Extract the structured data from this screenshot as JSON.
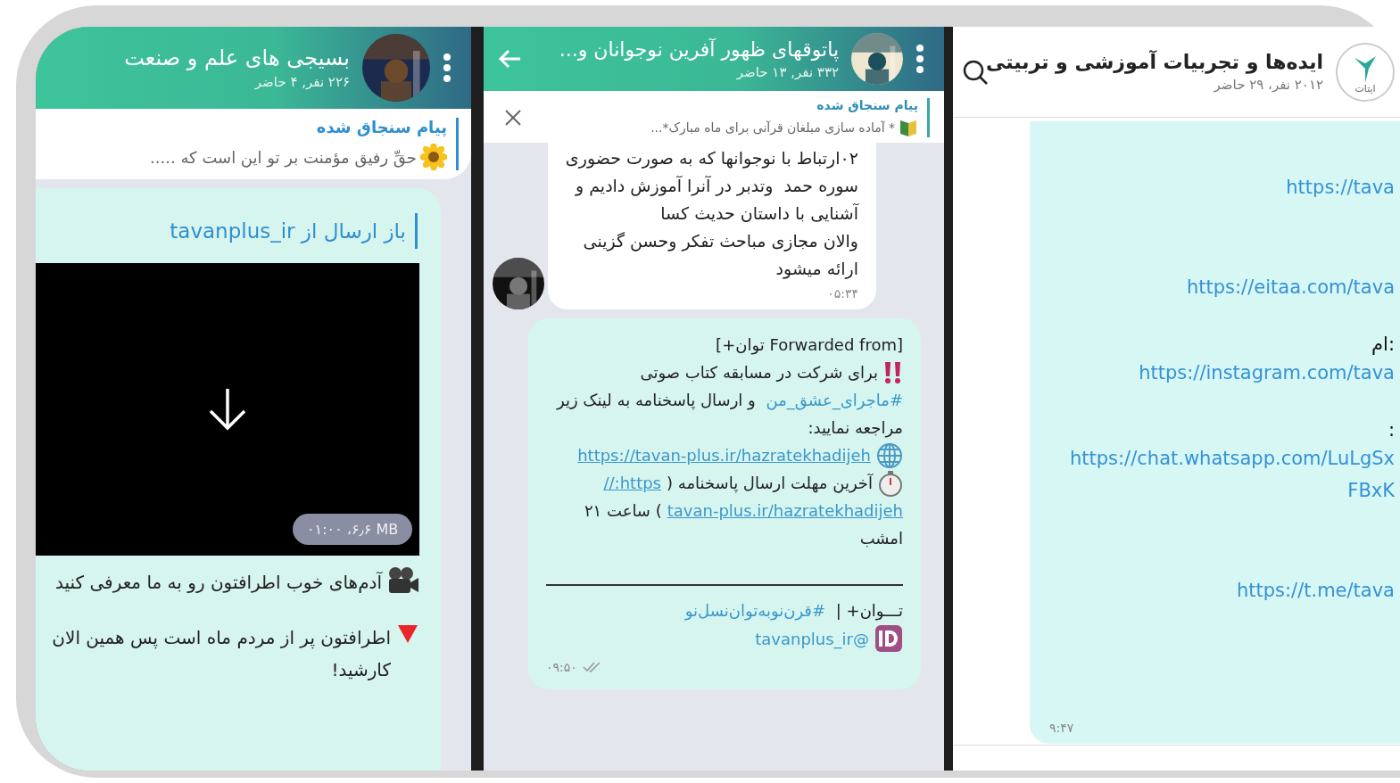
{
  "left_chat": {
    "header": {
      "title": "بسیجی های علم و صنعت",
      "subtitle": "۲۲۶ نفر, ۴ حاضر"
    },
    "pinned": {
      "label": "پیام سنجاق شده",
      "text": "حقِّ رفیق مؤمنت بر تو این است که ....."
    },
    "message": {
      "forward_label": "باز ارسال از tavanplus_ir",
      "video_info": "۰۱:۰۰ ،۶٫۶ MB",
      "lines": [
        {
          "kind": "camera",
          "text": "آدم‌های خوب اطرافتون رو به ما معرفی کنید"
        },
        {
          "kind": "triangle",
          "text": "اطرافتون پر از مردم ماه است پس همین الان\nکارشید!"
        }
      ]
    }
  },
  "middle_chat": {
    "header": {
      "title": "پاتوقهای ظهور آفرین نوجوانان و...",
      "subtitle": "۳۳۲ نفر, ۱۳ حاضر"
    },
    "pinned": {
      "label": "پیام سنجاق شده",
      "text": "* آماده سازی مبلغان قرآنی برای ماه مبارک*..."
    },
    "first_message": {
      "text": "۰۲ارتباط با نوجوانها که به صورت حضوری\nسوره حمد  وتدبر در آنرا آموزش دادیم و\nآشنایی با داستان حدیث کسا\nوالان مجازی مباحث تفکر وحسن گزینی\nارائه میشود",
      "time": "۰۵:۳۴"
    },
    "forwarded_message": {
      "blocks": [
        {
          "kind": "plain",
          "parts": [
            {
              "kind": "text",
              "text": "[Forwarded from توان+]"
            }
          ]
        },
        {
          "kind": "alert",
          "parts": [
            {
              "kind": "text",
              "text": "برای شرکت در مسابقه کتاب صوتی"
            }
          ]
        },
        {
          "kind": "plain",
          "parts": [
            {
              "kind": "hashtag",
              "text": "#ماجرای_عشق_من"
            },
            {
              "kind": "text",
              "text": " و ارسال پاسخنامه به لینک زیر"
            }
          ]
        },
        {
          "kind": "plain",
          "parts": [
            {
              "kind": "text",
              "text": "مراجعه نمایید:"
            }
          ]
        },
        {
          "kind": "web",
          "parts": [
            {
              "kind": "url",
              "text": "https://tavan-plus.ir/hazratekhadijeh"
            }
          ]
        },
        {
          "kind": "timer",
          "parts": [
            {
              "kind": "text",
              "text": "آخرین مهلت ارسال پاسخنامه ("
            },
            {
              "kind": "url",
              "text": "https://"
            }
          ]
        },
        {
          "kind": "plain",
          "parts": [
            {
              "kind": "url",
              "text": "tavan-plus.ir/hazratekhadijeh"
            },
            {
              "kind": "text",
              "text": ") ساعت ۲۱"
            }
          ]
        },
        {
          "kind": "plain",
          "parts": [
            {
              "kind": "text",
              "text": "امشب"
            }
          ]
        },
        {
          "kind": "rule"
        },
        {
          "kind": "plain",
          "parts": [
            {
              "kind": "text",
              "text": "تـــوان+ | "
            },
            {
              "kind": "hashtag",
              "text": "#قرن‌نوبه‌توان‌نسل‌نو"
            }
          ]
        },
        {
          "kind": "handle",
          "parts": [
            {
              "kind": "mention",
              "text": "@tavanplus_ir"
            }
          ]
        }
      ],
      "time": "۰۹:۵۰"
    }
  },
  "right_chat": {
    "header": {
      "title": "ایده‌ها و تجربیات آموزشی و تربیتی",
      "subtitle": "۲۰۱۲ نفر، ۲۹ حاضر",
      "logo_text": "ایتات"
    },
    "message": {
      "items": [
        {
          "kind": "link",
          "text": "https://tava"
        },
        {
          "kind": "link",
          "text": "https://eitaa.com/tava"
        },
        {
          "kind": "text",
          "text": "ام:"
        },
        {
          "kind": "link",
          "text": "https://instagram.com/tava"
        },
        {
          "kind": "text",
          "text": ":"
        },
        {
          "kind": "link",
          "text": "https://chat.whatsapp.com/LuLgSx"
        },
        {
          "kind": "link",
          "text": "FBxK"
        },
        {
          "kind": "link",
          "text": "https://t.me/tava"
        }
      ],
      "time": "۹:۴۷"
    }
  }
}
